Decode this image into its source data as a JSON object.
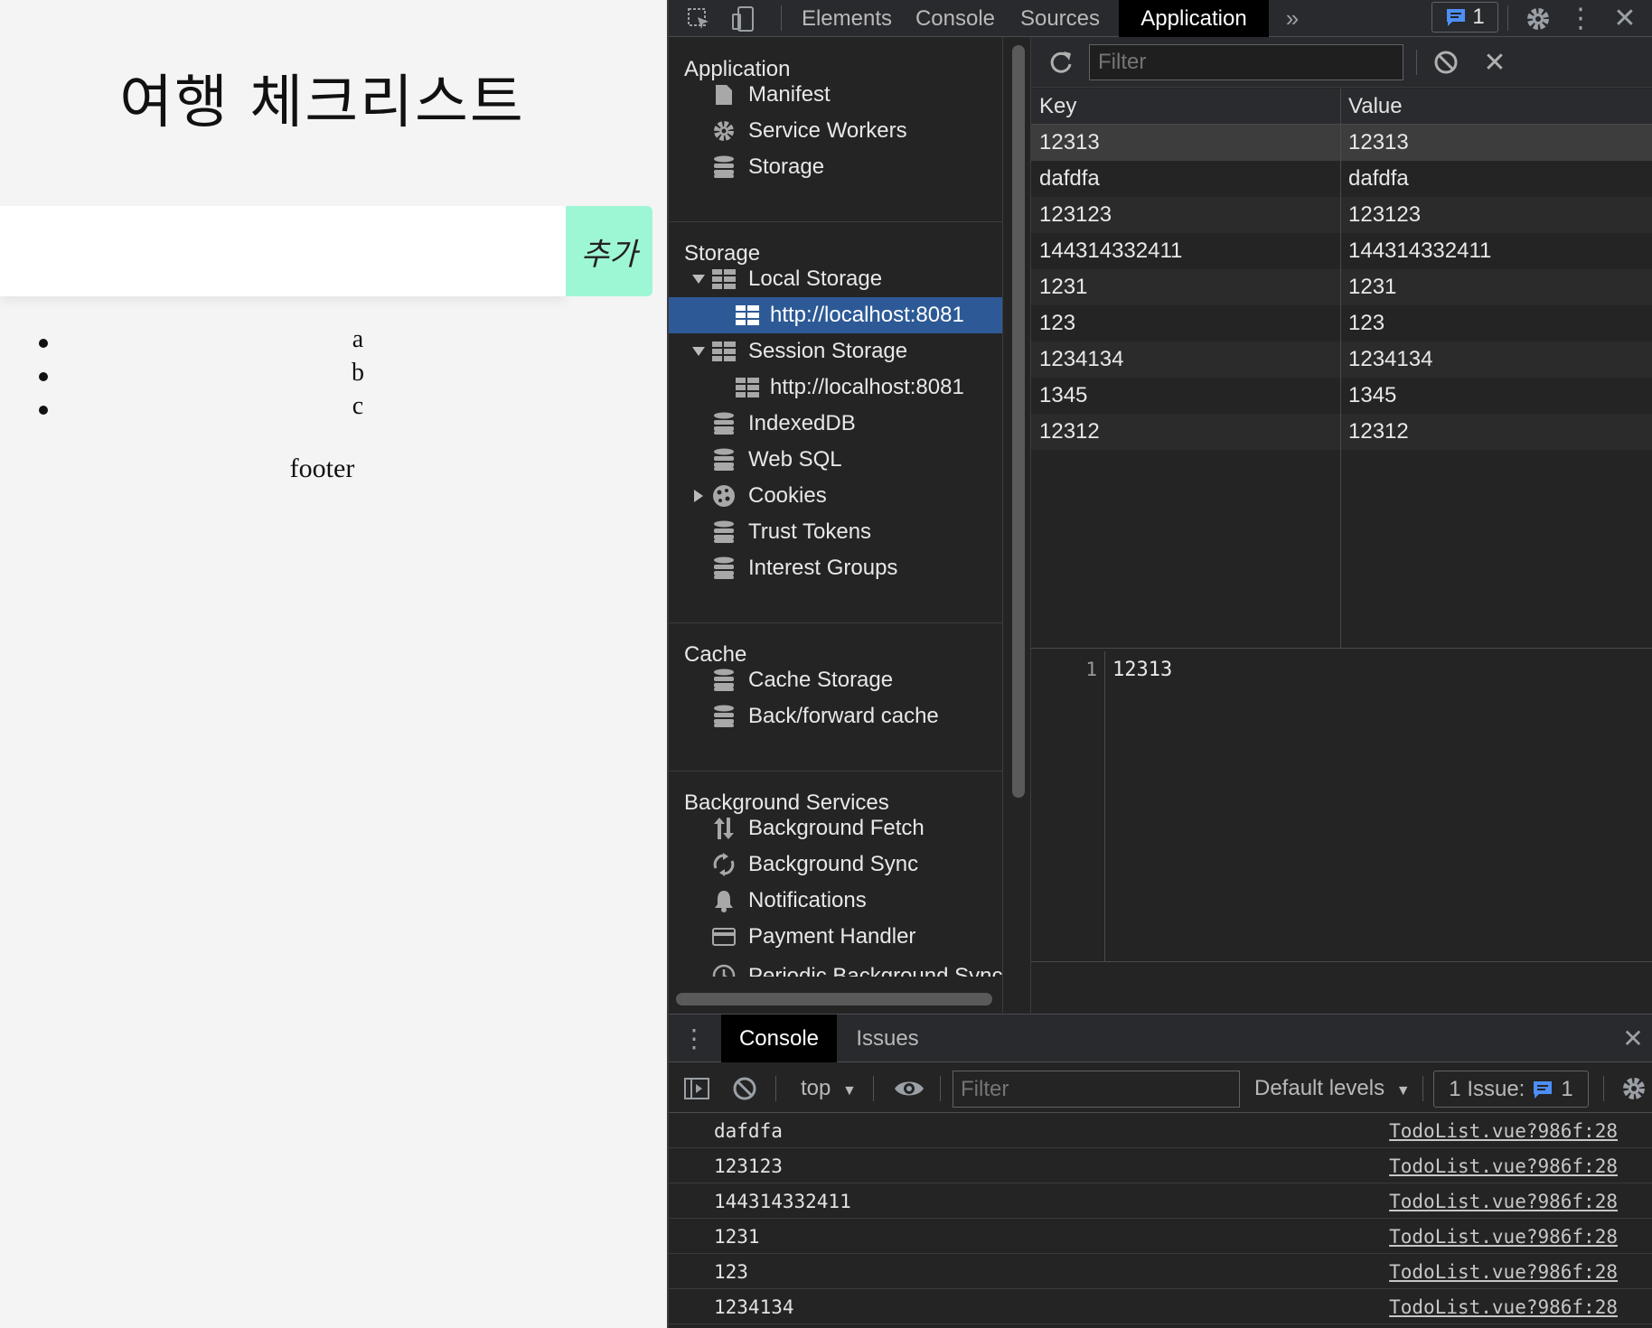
{
  "page": {
    "title": "여행 체크리스트",
    "add_button": "추가",
    "input_placeholder": "",
    "todos": [
      "a",
      "b",
      "c"
    ],
    "footer": "footer"
  },
  "devtools": {
    "tabs": [
      "Elements",
      "Console",
      "Sources",
      "Application"
    ],
    "active_tab": "Application",
    "issues_count": "1",
    "sidebar": {
      "application_header": "Application",
      "application_items": [
        "Manifest",
        "Service Workers",
        "Storage"
      ],
      "storage_header": "Storage",
      "local_storage": "Local Storage",
      "local_storage_origin": "http://localhost:8081",
      "session_storage": "Session Storage",
      "session_storage_origin": "http://localhost:8081",
      "storage_items": [
        "IndexedDB",
        "Web SQL",
        "Cookies",
        "Trust Tokens",
        "Interest Groups"
      ],
      "cache_header": "Cache",
      "cache_items": [
        "Cache Storage",
        "Back/forward cache"
      ],
      "bg_header": "Background Services",
      "bg_items": [
        "Background Fetch",
        "Background Sync",
        "Notifications",
        "Payment Handler",
        "Periodic Background Sync"
      ]
    },
    "storage": {
      "filter_placeholder": "Filter",
      "key_header": "Key",
      "value_header": "Value",
      "rows": [
        {
          "key": "12313",
          "value": "12313"
        },
        {
          "key": "dafdfa",
          "value": "dafdfa"
        },
        {
          "key": "123123",
          "value": "123123"
        },
        {
          "key": "144314332411",
          "value": "144314332411"
        },
        {
          "key": "1231",
          "value": "1231"
        },
        {
          "key": "123",
          "value": "123"
        },
        {
          "key": "1234134",
          "value": "1234134"
        },
        {
          "key": "1345",
          "value": "1345"
        },
        {
          "key": "12312",
          "value": "12312"
        }
      ],
      "preview_line": "1",
      "preview_value": "12313"
    },
    "drawer": {
      "tabs": [
        "Console",
        "Issues"
      ],
      "context": "top",
      "filter_placeholder": "Filter",
      "levels": "Default levels",
      "issue_label": "1 Issue:",
      "issue_count": "1",
      "logs": [
        {
          "msg": "dafdfa",
          "src": "TodoList.vue?986f:28"
        },
        {
          "msg": "123123",
          "src": "TodoList.vue?986f:28"
        },
        {
          "msg": "144314332411",
          "src": "TodoList.vue?986f:28"
        },
        {
          "msg": "1231",
          "src": "TodoList.vue?986f:28"
        },
        {
          "msg": "123",
          "src": "TodoList.vue?986f:28"
        },
        {
          "msg": "1234134",
          "src": "TodoList.vue?986f:28"
        }
      ]
    }
  },
  "colors": {
    "add_button_bg": "#9ef7d4",
    "selected_item_bg": "#2d5a96",
    "devtools_bg": "#242424",
    "badge_blue": "#4d8ef7"
  }
}
